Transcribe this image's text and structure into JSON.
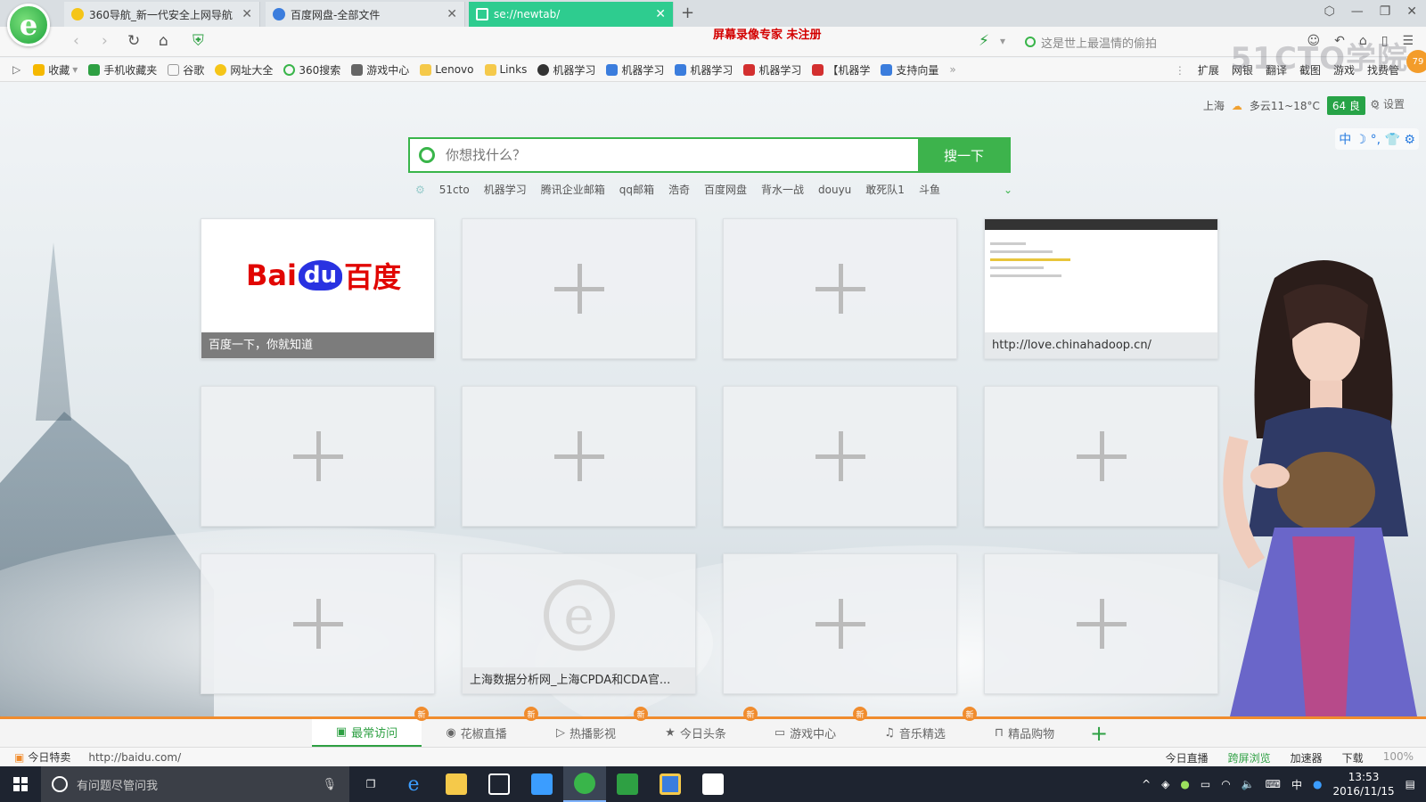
{
  "colors": {
    "accent_green": "#3db34c",
    "tab_active": "#2ecc8f",
    "orange": "#f08c2e",
    "watermark_red": "#d30000"
  },
  "tabs": [
    {
      "label": "360导航_新一代安全上网导航",
      "icon": "360-nav-icon"
    },
    {
      "label": "百度网盘-全部文件",
      "icon": "baidu-pan-icon"
    },
    {
      "label": "se://newtab/",
      "icon": "newtab-grid-icon",
      "active": true
    }
  ],
  "address": {
    "url": "",
    "watermark": "屏幕录像专家  未注册",
    "search_placeholder": "这是世上最温情的偷拍"
  },
  "overlay_logo": "51CTO学院",
  "badge": "79",
  "bookmarks": [
    {
      "label": "收藏",
      "icon": "star-icon"
    },
    {
      "label": "手机收藏夹",
      "icon": "phone-icon"
    },
    {
      "label": "谷歌",
      "icon": "page-icon"
    },
    {
      "label": "网址大全",
      "icon": "360-icon"
    },
    {
      "label": "360搜索",
      "icon": "360-search-icon"
    },
    {
      "label": "游戏中心",
      "icon": "gamepad-icon"
    },
    {
      "label": "Lenovo",
      "icon": "folder-icon"
    },
    {
      "label": "Links",
      "icon": "folder-icon"
    },
    {
      "label": "机器学习",
      "icon": "ml-icon"
    },
    {
      "label": "机器学习",
      "icon": "ml-icon"
    },
    {
      "label": "机器学习",
      "icon": "ml-icon"
    },
    {
      "label": "机器学习",
      "icon": "c-icon"
    },
    {
      "label": "【机器学",
      "icon": "c-icon"
    },
    {
      "label": "支持向量",
      "icon": "ml-icon"
    }
  ],
  "bookmark_more": "»",
  "bookmark_tools": [
    "扩展",
    "网银",
    "翻译",
    "截图",
    "游戏",
    "找费管"
  ],
  "weather": {
    "city": "上海",
    "desc": "多云11~18°C",
    "aqi": "64 良",
    "settings": "设置"
  },
  "ime_bar": "中 ☽ °, 👕 ⚙",
  "search": {
    "placeholder": "你想找什么？",
    "button": "搜一下"
  },
  "hotwords": [
    "51cto",
    "机器学习",
    "腾讯企业邮箱",
    "qq邮箱",
    "浩奇",
    "百度网盘",
    "背水一战",
    "douyu",
    "敢死队1",
    "斗鱼"
  ],
  "tiles": {
    "baidu": {
      "logo": "Bai du 百度",
      "caption": "百度一下，你就知道"
    },
    "chinahadoop": {
      "caption": "http://love.chinahadoop.cn/"
    },
    "cpda": {
      "caption": "上海数据分析网_上海CPDA和CDA官..."
    }
  },
  "bottom_tabs": [
    {
      "label": "最常访问",
      "active": true,
      "badge": "新"
    },
    {
      "label": "花椒直播",
      "badge": "新"
    },
    {
      "label": "热播影视",
      "badge": "新"
    },
    {
      "label": "今日头条",
      "badge": "新"
    },
    {
      "label": "游戏中心",
      "badge": "新"
    },
    {
      "label": "音乐精选",
      "badge": "新"
    },
    {
      "label": "精品购物",
      "badge": ""
    }
  ],
  "statusbar": {
    "today_deal": "今日特卖",
    "hover_url": "http://baidu.com/",
    "right": [
      "今日直播",
      "跨屏浏览",
      "加速器",
      "下载",
      "100%"
    ]
  },
  "taskbar": {
    "cortana": "有问题尽管问我",
    "time": "13:53",
    "date": "2016/11/15",
    "ime": "中"
  }
}
